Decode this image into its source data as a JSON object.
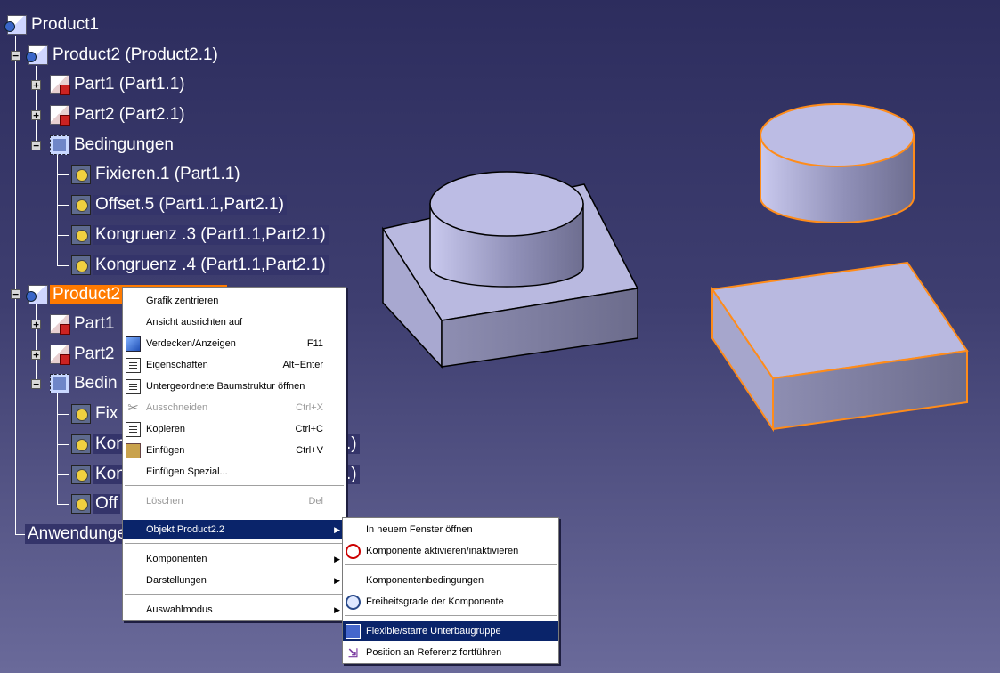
{
  "tree": {
    "root": "Product1",
    "product2_1": "Product2 (Product2.1)",
    "p1_part1": "Part1 (Part1.1)",
    "p1_part2": "Part2 (Part2.1)",
    "p1_bed": "Bedingungen",
    "p1_c1": "Fixieren.1 (Part1.1)",
    "p1_c2": "Offset.5 (Part1.1,Part2.1)",
    "p1_c3": "Kongruenz .3 (Part1.1,Part2.1)",
    "p1_c4": "Kongruenz .4 (Part1.1,Part2.1)",
    "product2_2": "Product2",
    "p2_part1": "Part1",
    "p2_part2": "Part2",
    "p2_bed": "Bedin",
    "p2_c1": "Fix",
    "p2_c2": "Kon",
    "p2_c2_tail": ".)",
    "p2_c3": "Kon",
    "p2_c3_tail": ".)",
    "p2_c4": "Off",
    "app": "Anwendunge"
  },
  "context_menu": {
    "items": [
      {
        "label": "Grafik zentrieren",
        "shortcut": "",
        "icon": "",
        "disabled": false
      },
      {
        "label": "Ansicht ausrichten auf",
        "shortcut": "",
        "icon": "",
        "disabled": false
      },
      {
        "label": "Verdecken/Anzeigen",
        "shortcut": "F11",
        "icon": "hide-show-icon",
        "disabled": false
      },
      {
        "label": "Eigenschaften",
        "shortcut": "Alt+Enter",
        "icon": "properties-icon",
        "disabled": false
      },
      {
        "label": "Untergeordnete Baumstruktur öffnen",
        "shortcut": "",
        "icon": "subtree-icon",
        "disabled": false
      },
      {
        "label": "Ausschneiden",
        "shortcut": "Ctrl+X",
        "icon": "scissors-icon",
        "disabled": true
      },
      {
        "label": "Kopieren",
        "shortcut": "Ctrl+C",
        "icon": "copy-icon",
        "disabled": false
      },
      {
        "label": "Einfügen",
        "shortcut": "Ctrl+V",
        "icon": "paste-icon",
        "disabled": false
      },
      {
        "label": "Einfügen Spezial...",
        "shortcut": "",
        "icon": "",
        "disabled": false
      },
      {
        "label": "Löschen",
        "shortcut": "Del",
        "icon": "",
        "disabled": true
      },
      {
        "label": "Objekt Product2.2",
        "shortcut": "",
        "icon": "",
        "disabled": false
      },
      {
        "label": "Komponenten",
        "shortcut": "",
        "icon": "",
        "disabled": false
      },
      {
        "label": "Darstellungen",
        "shortcut": "",
        "icon": "",
        "disabled": false
      },
      {
        "label": "Auswahlmodus",
        "shortcut": "",
        "icon": "",
        "disabled": false
      }
    ]
  },
  "submenu": {
    "items": [
      {
        "label": "In neuem Fenster öffnen",
        "icon": ""
      },
      {
        "label": "Komponente aktivieren/inaktivieren",
        "icon": "activate-icon"
      },
      {
        "label": "Komponentenbedingungen",
        "icon": ""
      },
      {
        "label": "Freiheitsgrade der Komponente",
        "icon": "dof-icon"
      },
      {
        "label": "Flexible/starre Unterbaugruppe",
        "icon": "flexible-icon"
      },
      {
        "label": "Position an Referenz fortführen",
        "icon": "position-icon"
      }
    ]
  },
  "colors": {
    "background_top": "#2d2d5e",
    "selection_orange": "#ff7a00",
    "menu_selected": "#0a246a",
    "solid_face": "#b8b8e0",
    "solid_edge_selected": "#ff8c1a"
  }
}
